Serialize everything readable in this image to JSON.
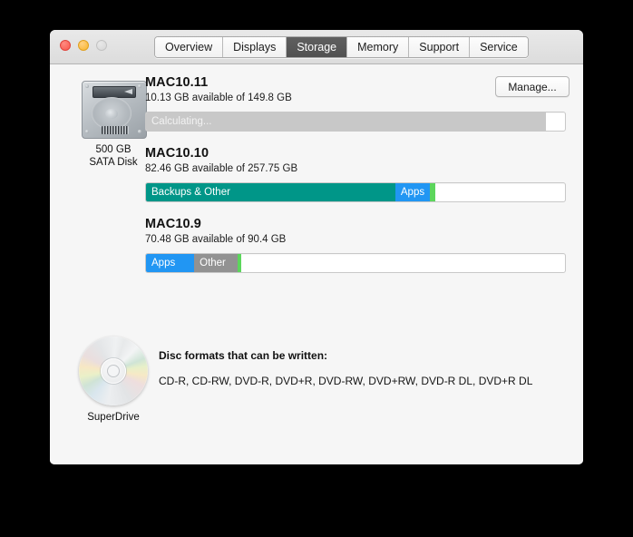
{
  "window": {
    "traffic_lights": [
      "close",
      "minimize",
      "zoom"
    ],
    "tabs": [
      {
        "label": "Overview",
        "selected": false
      },
      {
        "label": "Displays",
        "selected": false
      },
      {
        "label": "Storage",
        "selected": true
      },
      {
        "label": "Memory",
        "selected": false
      },
      {
        "label": "Support",
        "selected": false
      },
      {
        "label": "Service",
        "selected": false
      }
    ]
  },
  "disk": {
    "icon": "hard-disk-icon",
    "capacity_label": "500 GB",
    "type_label": "SATA Disk"
  },
  "manage_button": {
    "label": "Manage..."
  },
  "volumes": [
    {
      "name": "MAC10.11",
      "available_text": "10.13 GB available of 149.8 GB",
      "segments": [
        {
          "label": "Calculating...",
          "percent": 95.5,
          "color": "#c8c8c8",
          "kind": "calculating"
        },
        {
          "label": "",
          "percent": 4.5,
          "color": "#ffffff",
          "kind": "free"
        }
      ]
    },
    {
      "name": "MAC10.10",
      "available_text": "82.46 GB available of 257.75 GB",
      "segments": [
        {
          "label": "Backups & Other",
          "percent": 59.5,
          "color": "#009688",
          "kind": "used"
        },
        {
          "label": "Apps",
          "percent": 8.2,
          "color": "#2196f3",
          "kind": "used"
        },
        {
          "label": "",
          "percent": 1.4,
          "color": "#5cd65c",
          "kind": "used"
        },
        {
          "label": "",
          "percent": 30.9,
          "color": "#ffffff",
          "kind": "free"
        }
      ]
    },
    {
      "name": "MAC10.9",
      "available_text": "70.48 GB available of 90.4 GB",
      "segments": [
        {
          "label": "Apps",
          "percent": 11.5,
          "color": "#2196f3",
          "kind": "used"
        },
        {
          "label": "Other",
          "percent": 10.4,
          "color": "#929292",
          "kind": "used"
        },
        {
          "label": "",
          "percent": 0.9,
          "color": "#5cd65c",
          "kind": "used"
        },
        {
          "label": "",
          "percent": 77.2,
          "color": "#ffffff",
          "kind": "free"
        }
      ]
    }
  ],
  "optical": {
    "icon": "optical-disc-icon",
    "name": "SuperDrive",
    "formats_title": "Disc formats that can be written:",
    "formats_list": "CD-R, CD-RW, DVD-R, DVD+R, DVD-RW, DVD+RW, DVD-R DL, DVD+R DL"
  }
}
